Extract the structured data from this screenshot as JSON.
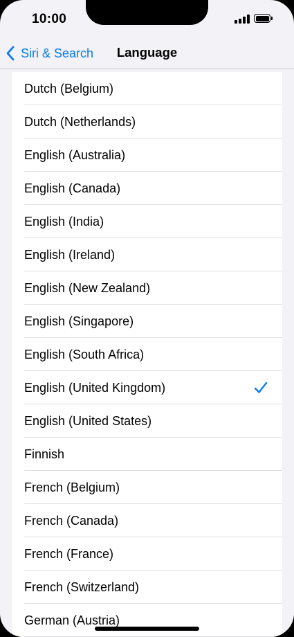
{
  "status_bar": {
    "time": "10:00"
  },
  "nav": {
    "back_label": "Siri & Search",
    "title": "Language"
  },
  "colors": {
    "accent": "#0a7cf0",
    "background": "#f2f2f7"
  },
  "languages": [
    {
      "label": "Dutch (Belgium)",
      "selected": false
    },
    {
      "label": "Dutch (Netherlands)",
      "selected": false
    },
    {
      "label": "English (Australia)",
      "selected": false
    },
    {
      "label": "English (Canada)",
      "selected": false
    },
    {
      "label": "English (India)",
      "selected": false
    },
    {
      "label": "English (Ireland)",
      "selected": false
    },
    {
      "label": "English (New Zealand)",
      "selected": false
    },
    {
      "label": "English (Singapore)",
      "selected": false
    },
    {
      "label": "English (South Africa)",
      "selected": false
    },
    {
      "label": "English (United Kingdom)",
      "selected": true
    },
    {
      "label": "English (United States)",
      "selected": false
    },
    {
      "label": "Finnish",
      "selected": false
    },
    {
      "label": "French (Belgium)",
      "selected": false
    },
    {
      "label": "French (Canada)",
      "selected": false
    },
    {
      "label": "French (France)",
      "selected": false
    },
    {
      "label": "French (Switzerland)",
      "selected": false
    },
    {
      "label": "German (Austria)",
      "selected": false
    }
  ]
}
